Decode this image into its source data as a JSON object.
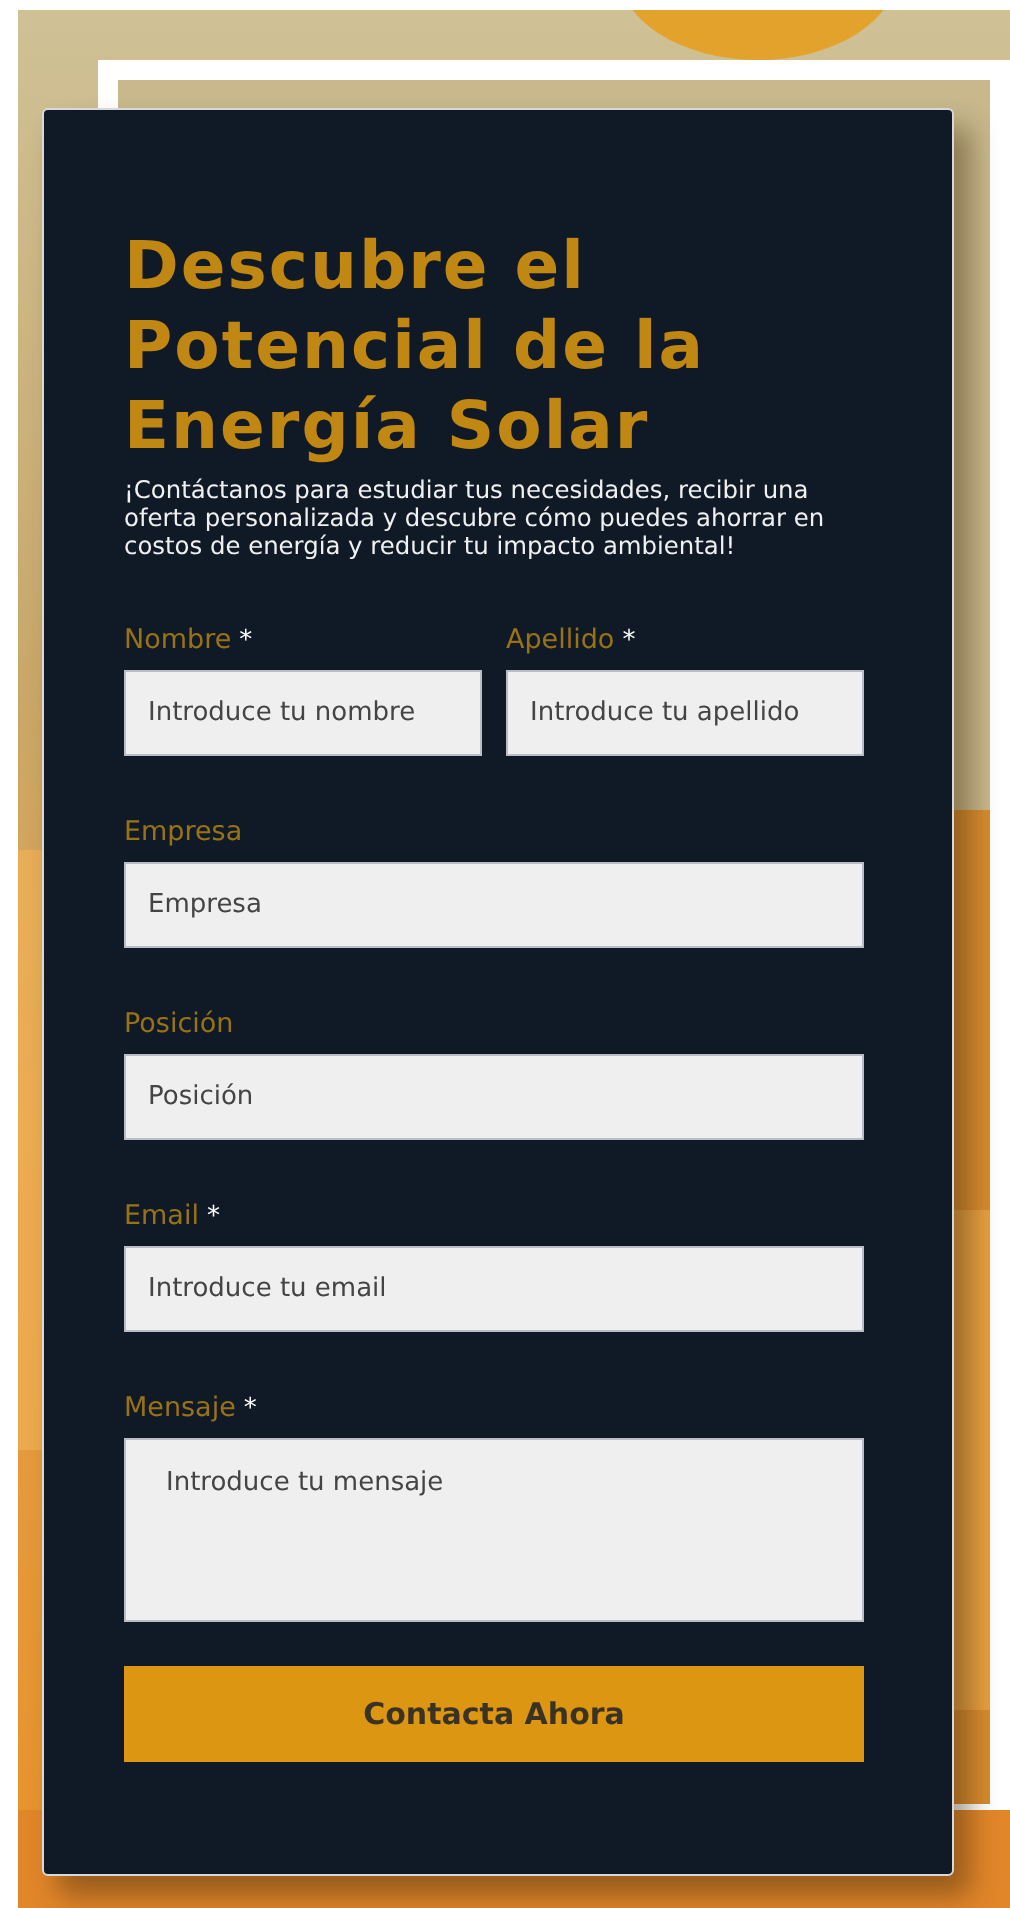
{
  "form": {
    "title": "Descubre el Potencial de la Energía Solar",
    "description": "¡Contáctanos para estudiar tus necesidades, recibir una oferta personalizada y descubre cómo puedes ahorrar en costos de energía y reducir tu impacto ambiental!",
    "rows": [
      [
        {
          "label": "Nombre",
          "mark": "*",
          "kind": "text",
          "placeholder": "Introduce tu nombre"
        },
        {
          "label": "Apellido",
          "mark": "*",
          "kind": "text",
          "placeholder": "Introduce tu apellido"
        }
      ],
      [
        {
          "label": "Empresa",
          "kind": "text",
          "placeholder": "Empresa"
        }
      ],
      [
        {
          "label": "Posición",
          "kind": "text",
          "placeholder": "Posición"
        }
      ],
      [
        {
          "label": "Email",
          "mark": "*",
          "kind": "text",
          "placeholder": "Introduce tu email"
        }
      ],
      [
        {
          "label": "Mensaje",
          "mark": "*",
          "kind": "textarea",
          "placeholder": "Introduce tu mensaje"
        }
      ]
    ],
    "submit": "Contacta Ahora"
  }
}
